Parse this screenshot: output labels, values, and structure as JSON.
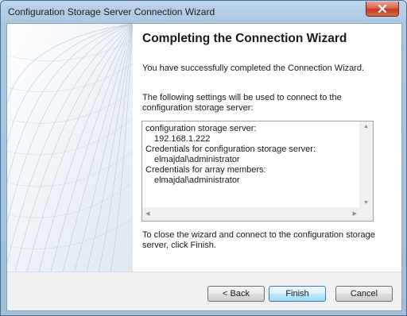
{
  "window": {
    "title": "Configuration Storage Server Connection Wizard"
  },
  "page": {
    "heading": "Completing the Connection Wizard",
    "intro": "You have successfully completed the Connection Wizard.",
    "settings_intro": "The following settings will be used to connect to the configuration storage server:",
    "summary": {
      "server_label": "configuration storage server:",
      "server_value": "192.168.1.222",
      "credentials_server_label": "Credentials for configuration storage server:",
      "credentials_server_value": "elmajdal\\administrator",
      "credentials_array_label": "Credentials for array members:",
      "credentials_array_value": "elmajdal\\administrator"
    },
    "close_instruction": "To close the wizard and connect to the configuration storage server, click Finish."
  },
  "buttons": {
    "back": "< Back",
    "finish": "Finish",
    "cancel": "Cancel"
  }
}
